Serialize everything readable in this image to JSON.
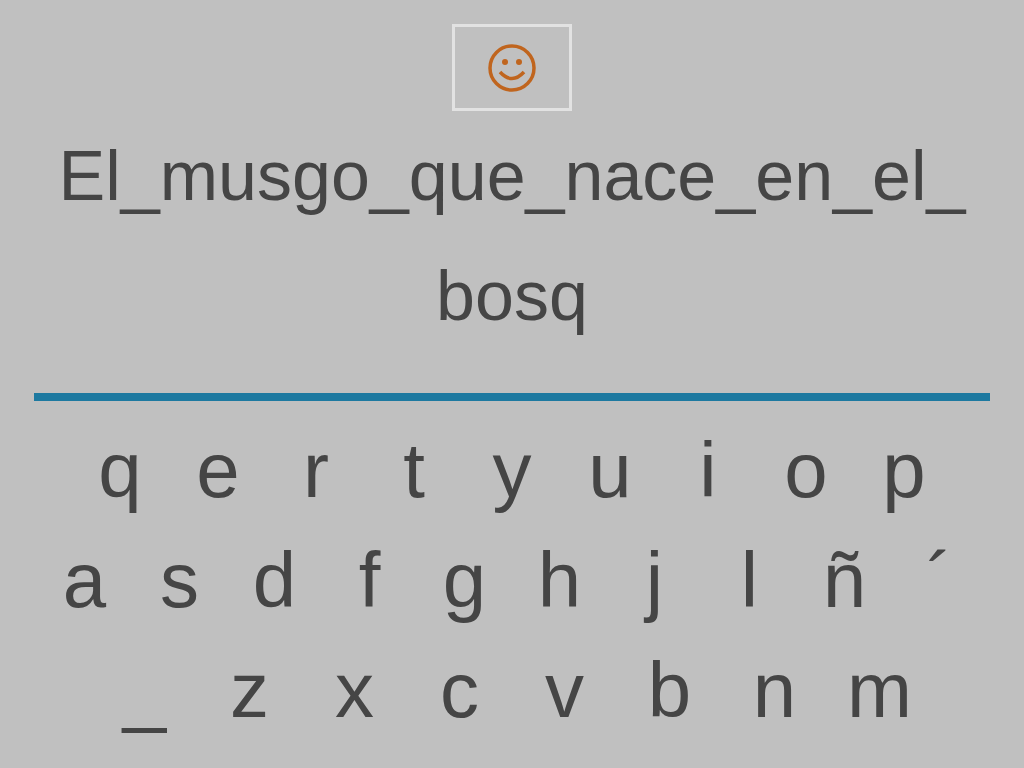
{
  "phrase_lines": [
    "El_musgo_que_nace_en_el_",
    "bosq"
  ],
  "keyboard_rows": [
    [
      "q",
      "e",
      "r",
      "t",
      "y",
      "u",
      "i",
      "o",
      "p"
    ],
    [
      "a",
      "s",
      "d",
      "f",
      "g",
      "h",
      "j",
      "l",
      "ñ",
      "´"
    ],
    [
      "_",
      "z",
      "x",
      "c",
      "v",
      "b",
      "n",
      "m"
    ]
  ]
}
